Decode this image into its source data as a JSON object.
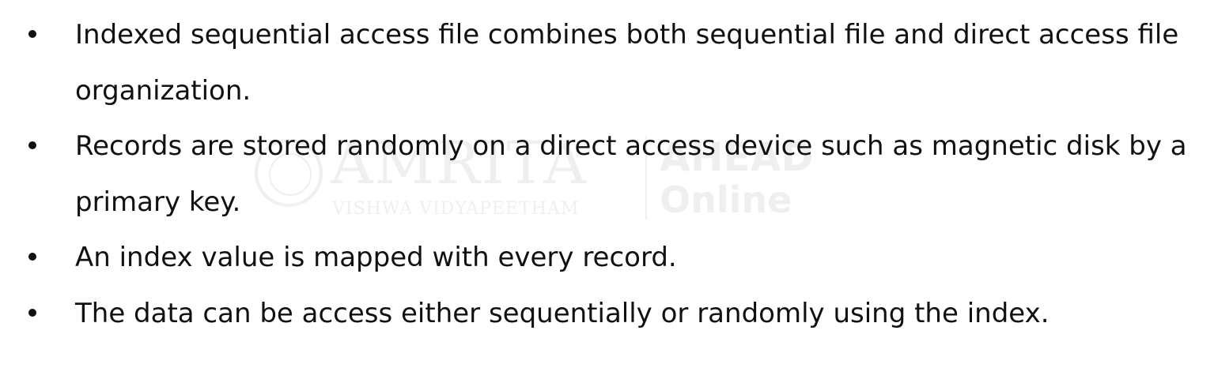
{
  "watermark": {
    "name": "AMRITA",
    "subtitle": "VISHWA VIDYAPEETHAM",
    "brand_top": "AHEAD",
    "brand_bottom": "Online"
  },
  "bullets": [
    {
      "text": "Indexed sequential access file combines both sequential file and direct access file organization."
    },
    {
      "text": "Records are stored randomly on a direct access device such as magnetic disk by a primary key."
    },
    {
      "text": "An index value is mapped with every record."
    },
    {
      "text": "The data can be access either sequentially or randomly using the index."
    }
  ]
}
